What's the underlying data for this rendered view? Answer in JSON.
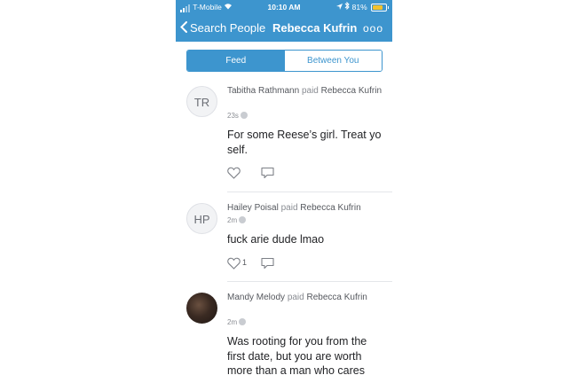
{
  "status_bar": {
    "carrier": "T-Mobile",
    "time": "10:10 AM",
    "battery": "81%",
    "battery_level": 0.81
  },
  "nav": {
    "back_label": "Search People",
    "title": "Rebecca Kufrin",
    "more": "ooo"
  },
  "tabs": [
    {
      "label": "Feed",
      "active": true
    },
    {
      "label": "Between You",
      "active": false
    }
  ],
  "feed": [
    {
      "avatar_initials": "TR",
      "actor": "Tabitha Rathmann",
      "verb": "paid",
      "target": "Rebecca Kufrin",
      "time": "23s",
      "note": "For some Reese’s girl. Treat yo self.",
      "likes": ""
    },
    {
      "avatar_initials": "HP",
      "actor": "Hailey Poisal",
      "verb": "paid",
      "target": "Rebecca Kufrin",
      "time": "2m",
      "note": "fuck arie dude lmao",
      "likes": "1"
    },
    {
      "avatar_initials": "",
      "actor": "Mandy Melody",
      "verb": "paid",
      "target": "Rebecca Kufrin",
      "time": "2m",
      "note": "Was rooting for you from the first date, but you are worth more than a man who cares",
      "likes": ""
    }
  ],
  "icons": {
    "like": "heart-icon",
    "comment": "comment-bubble-icon",
    "privacy": "globe-icon",
    "back": "chevron-left-icon"
  },
  "colors": {
    "brand": "#3d95ce",
    "battery": "#f2c12e"
  }
}
